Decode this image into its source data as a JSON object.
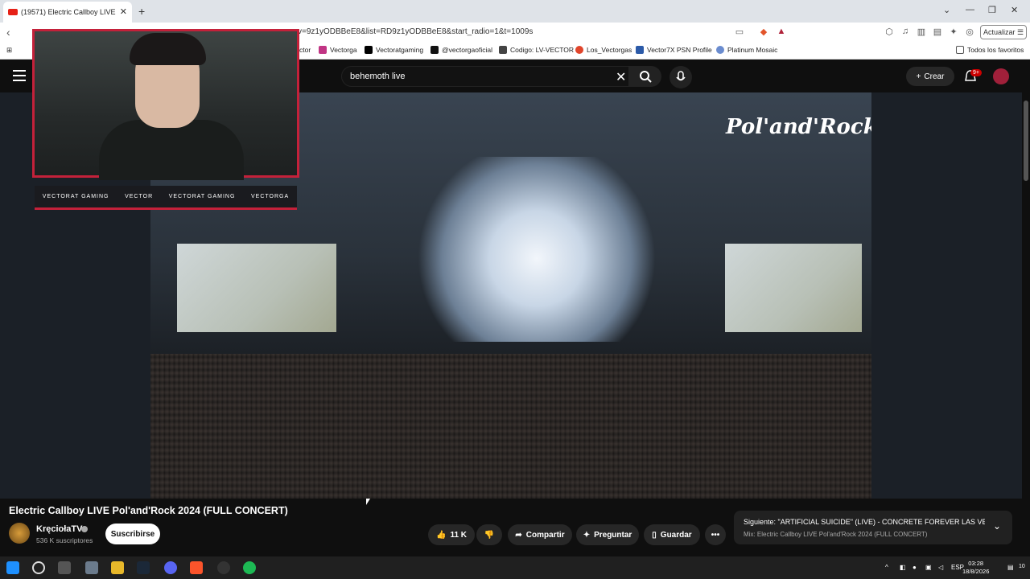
{
  "browser": {
    "tab_title": "(19571) Electric Callboy LIVE",
    "url": "v=9z1yODBBeE8&list=RD9z1yODBBeE8&start_radio=1&t=1009s",
    "update_label": "Actualizar",
    "bookmarks": [
      "ctor",
      "Vectorga",
      "Vectoratgaming",
      "@vectorgaoficial",
      "Codigo: LV-VECTOR",
      "Los_Vectorgas",
      "Vector7X PSN Profile",
      "Platinum Mosaic"
    ],
    "all_favorites": "Todos los favoritos"
  },
  "youtube": {
    "search_query": "behemoth live",
    "create_label": "Crear",
    "notif_badge": "9+",
    "video_title": "Electric Callboy LIVE Pol'and'Rock 2024 (FULL CONCERT)",
    "channel_name": "KręciołaTV",
    "subscribers": "536 K suscriptores",
    "subscribe_label": "Suscribirse",
    "likes": "11 K",
    "share_label": "Compartir",
    "ask_label": "Preguntar",
    "save_label": "Guardar",
    "next_title": "Siguiente: \"ARTIFICIAL SUICIDE\" (LIVE) - CONCRETE FOREVER LAS VE...",
    "next_sub": "Mix: Electric Callboy LIVE Pol'and'Rock 2024 (FULL CONCERT)",
    "video_logo": "Pol'and'Rock"
  },
  "overlay": {
    "socials": [
      "VECTORAT GAMING",
      "VECTOR",
      "VECTORAT GAMING",
      "VECTORGA"
    ]
  },
  "taskbar": {
    "lang": "ESP",
    "time": "03:28",
    "date": "18/8/2026",
    "notifications": "10"
  }
}
